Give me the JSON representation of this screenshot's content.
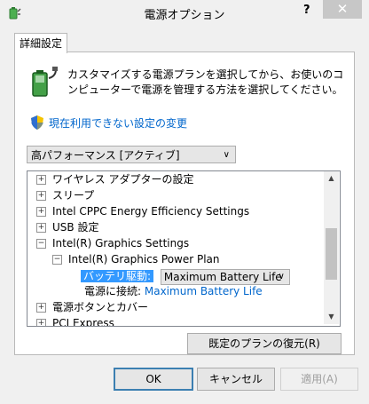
{
  "window": {
    "title": "電源オプション",
    "help_glyph": "?",
    "close_glyph": "✕"
  },
  "tabs": [
    {
      "label": "詳細設定"
    }
  ],
  "intro_text": "カスタマイズする電源プランを選択してから、お使いのコンピューターで電源を管理する方法を選択してください。",
  "link_unavailable": "現在利用できない設定の変更",
  "plan_dropdown": {
    "selected": "高パフォーマンス [アクティブ]"
  },
  "tree": {
    "rows": [
      {
        "label": "ワイヤレス アダプターの設定",
        "expander": "+"
      },
      {
        "label": "スリープ",
        "expander": "+"
      },
      {
        "label": "Intel CPPC Energy Efficiency Settings",
        "expander": "+"
      },
      {
        "label": "USB 設定",
        "expander": "+"
      },
      {
        "label": "Intel(R) Graphics Settings",
        "expander": "−"
      },
      {
        "label": "Intel(R) Graphics Power Plan",
        "expander": "−"
      },
      {
        "label": "電源ボタンとカバー",
        "expander": "+"
      },
      {
        "label": "PCI Express",
        "expander": "+"
      }
    ],
    "battery_label": "バッテリ駆動:",
    "battery_value": "Maximum Battery Life",
    "ac_label": "電源に接続:",
    "ac_value": "Maximum Battery Life"
  },
  "buttons": {
    "restore": "既定のプランの復元(R)",
    "ok": "OK",
    "cancel": "キャンセル",
    "apply": "適用(A)"
  },
  "icons": {
    "app": "power-options-icon",
    "battery": "battery-plug-icon",
    "shield": "uac-shield-icon"
  }
}
